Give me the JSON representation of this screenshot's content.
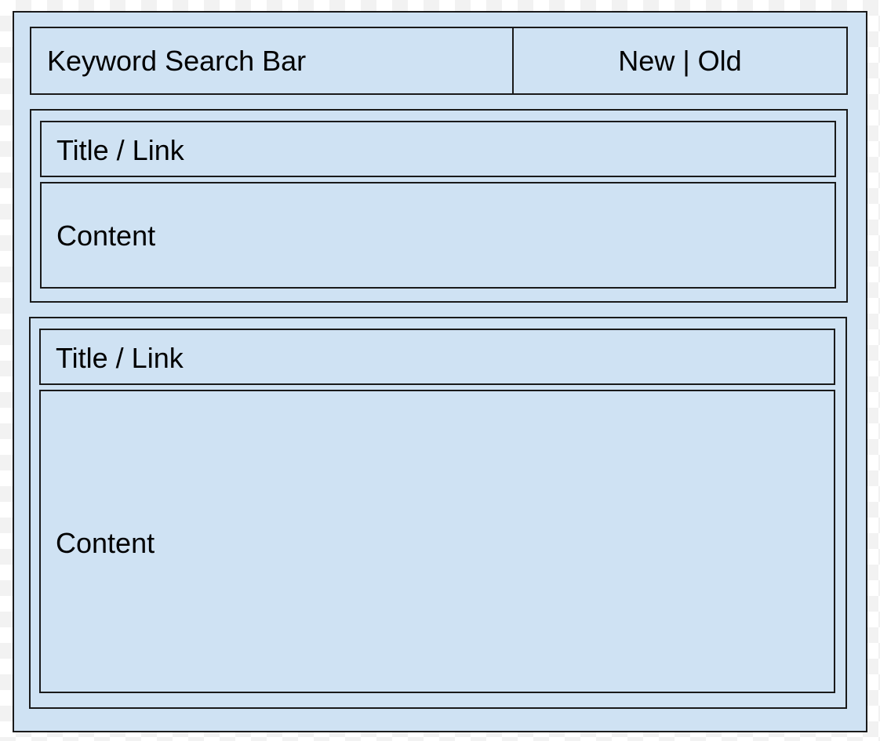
{
  "colors": {
    "box_fill": "#cfe2f3",
    "border": "#1a1a1a",
    "text": "#000000"
  },
  "header": {
    "search_label": "Keyword Search Bar",
    "sort_label": "New | Old"
  },
  "posts": [
    {
      "title": "Title / Link",
      "content": "Content"
    },
    {
      "title": "Title / Link",
      "content": "Content"
    }
  ]
}
